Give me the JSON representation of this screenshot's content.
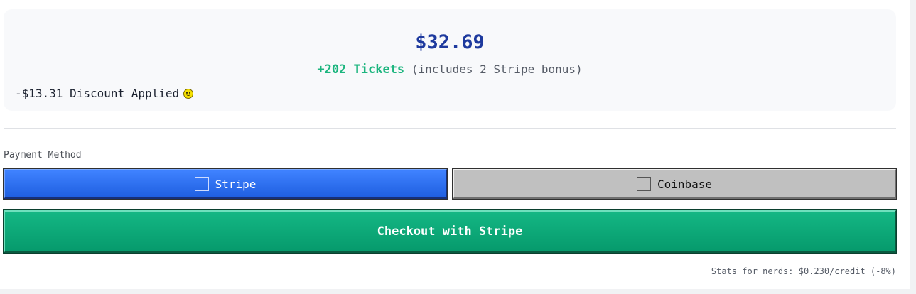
{
  "summary": {
    "price": "$32.69",
    "tickets_amount": "+202 Tickets",
    "tickets_note": "(includes 2 Stripe bonus)",
    "discount_text": "-$13.31 Discount Applied",
    "discount_icon": "smiley-icon"
  },
  "payment": {
    "label": "Payment Method",
    "methods": [
      {
        "label": "Stripe",
        "selected": true,
        "color": "#2f6ff0"
      },
      {
        "label": "Coinbase",
        "selected": false,
        "color": "#c0c0c0"
      }
    ]
  },
  "checkout": {
    "label": "Checkout with Stripe",
    "color": "#0ea877"
  },
  "stats": {
    "text": "Stats for nerds: $0.230/credit (-8%)"
  },
  "colors": {
    "price": "#1e3a9e",
    "tickets": "#1cb57e"
  }
}
